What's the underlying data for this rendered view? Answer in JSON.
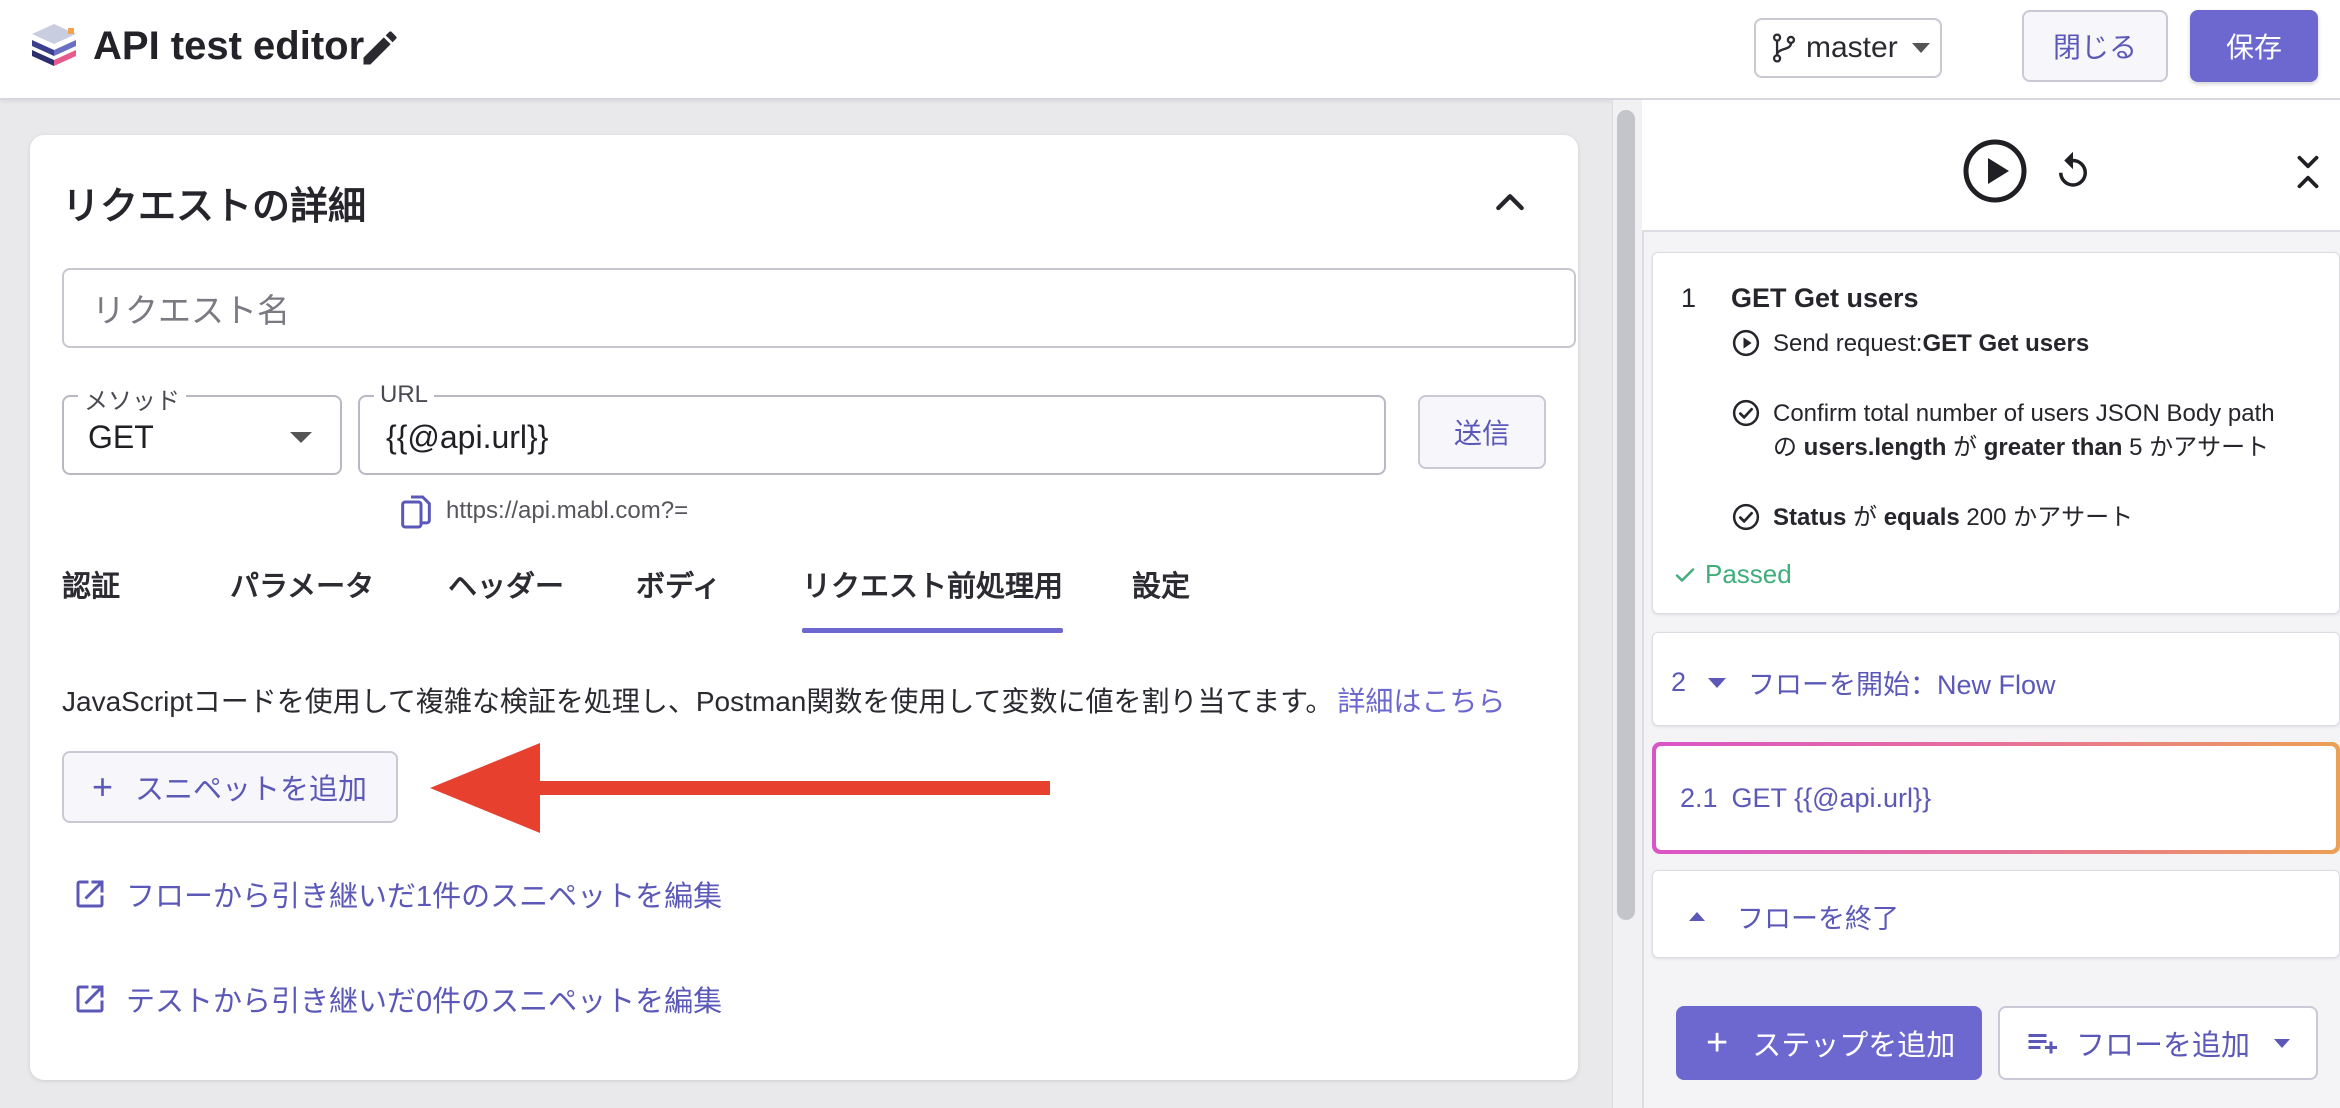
{
  "header": {
    "app_title": "API test editor",
    "branch": "master",
    "close_label": "閉じる",
    "save_label": "保存"
  },
  "request": {
    "section_title": "リクエストの詳細",
    "name_placeholder": "リクエスト名",
    "method_label": "メソッド",
    "method_value": "GET",
    "url_label": "URL",
    "url_value": "{{@api.url}}",
    "send_label": "送信",
    "resolved_url": "https://api.mabl.com?="
  },
  "tabs": [
    {
      "label": "認証"
    },
    {
      "label": "パラメータ"
    },
    {
      "label": "ヘッダー"
    },
    {
      "label": "ボディ"
    },
    {
      "label": "リクエスト前処理用",
      "active": true
    },
    {
      "label": "設定"
    }
  ],
  "pre_request": {
    "description": "JavaScriptコードを使用して複雑な検証を処理し、Postman関数を使用して変数に値を割り当てます。",
    "learn_more": "詳細はこちら",
    "add_snippet_label": "スニペットを追加",
    "flow_snippets_link": "フローから引き継いだ1件のスニペットを編集",
    "test_snippets_link": "テストから引き継いだ0件のスニペットを編集"
  },
  "steps": {
    "step1": {
      "number": "1",
      "title": "GET Get users",
      "sub1_prefix": "Send request:",
      "sub1_bold": "GET Get users",
      "sub2_line1": "Confirm total number of users JSON Body path",
      "sub2_no": "の",
      "sub2_path": "users.length",
      "sub2_ga": "が",
      "sub2_op": "greater than",
      "sub2_val": "5 かアサート",
      "sub3_field": "Status",
      "sub3_ga": "が",
      "sub3_op": "equals",
      "sub3_val": "200 かアサート",
      "status": "Passed"
    },
    "step2": {
      "number": "2",
      "label": "フローを開始：New Flow"
    },
    "step21": {
      "number": "2.1",
      "label": "GET {{@api.url}}"
    },
    "step3": {
      "label": "フローを終了"
    },
    "add_step_label": "ステップを追加",
    "add_flow_label": "フローを追加"
  },
  "colors": {
    "accent": "#6d68cf",
    "passed": "#3fae7b",
    "annotation_arrow": "#e8402e"
  }
}
